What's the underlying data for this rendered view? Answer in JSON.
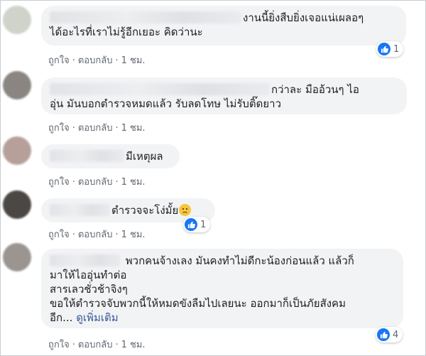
{
  "actions": {
    "like": "ถูกใจ",
    "reply": "ตอบกลับ",
    "separator": "·"
  },
  "comments": [
    {
      "avatar_color": "#cfd3c9",
      "lines": [
        "งานนี้ยิ่งสืบยิ่งเจอแน่เผลอๆ",
        "ได้อะไรที่เราไม่รู้อีกเยอะ คิดว่านะ"
      ],
      "time": "1 ชม.",
      "reaction_count": "1"
    },
    {
      "avatar_color": "#8a8580",
      "lines": [
        "กว่าละ มืออ้วนๆ ไอ",
        "อุ่น มันบอกตำรวจหมดแล้ว รับลดโทษ ไม่รับติ๊ดยาว"
      ],
      "time": "1 ชม."
    },
    {
      "avatar_color": "#b8a09a",
      "lines": [
        "มีเหตุผล"
      ],
      "time": "1 ชม."
    },
    {
      "avatar_color": "#4a4744",
      "lines": [
        "ตำรวจจะโง่มั้ย"
      ],
      "time": "1 ชม.",
      "reaction_count": "1"
    },
    {
      "avatar_color": "#9a9591",
      "lines": [
        "พวกคนจ้างเลง มันคงทำไม่ดีกะน้องก่อนแล้ว แล้วก็",
        "มาให้ไออุ่นทำต่อ",
        "สารเลวชั่วช้าจิงๆ",
        "ขอให้ตำรวจจับพวกนี้ให้หมดขังลืมไปเลยนะ ออกมาก็เป็นภัยสังคม",
        "อีก..."
      ],
      "see_more": "ดูเพิ่มเติม",
      "time": "1 ชม.",
      "reaction_count": "4"
    }
  ]
}
